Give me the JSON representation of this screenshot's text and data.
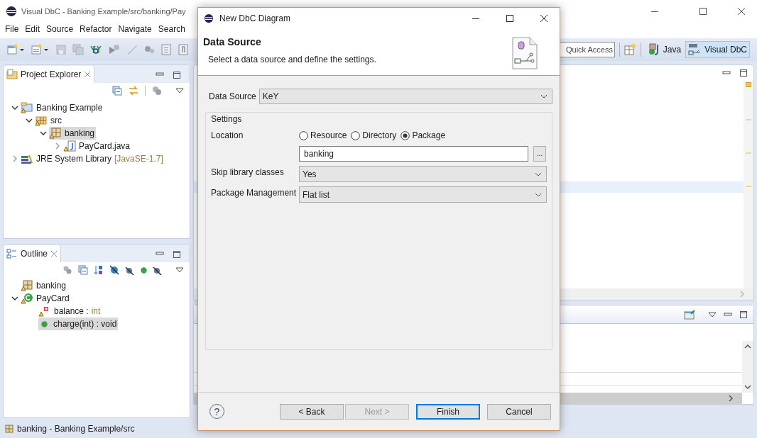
{
  "window": {
    "title": "Visual DbC - Banking Example/src/banking/Pay"
  },
  "menu": [
    "File",
    "Edit",
    "Source",
    "Refactor",
    "Navigate",
    "Search"
  ],
  "quick_access": {
    "placeholder": "Quick Access"
  },
  "perspectives": [
    {
      "label": "Java",
      "kind": "java",
      "selected": false
    },
    {
      "label": "Visual DbC",
      "kind": "dbc",
      "selected": true
    }
  ],
  "project_explorer": {
    "title": "Project Explorer",
    "tree": [
      {
        "label": "Banking Example",
        "kind": "project",
        "expanded": true,
        "selected": false,
        "children": [
          {
            "label": "src",
            "kind": "source-folder",
            "expanded": true,
            "selected": false,
            "children": [
              {
                "label": "banking",
                "kind": "package",
                "expanded": true,
                "selected": true,
                "children": [
                  {
                    "label": "PayCard.java",
                    "kind": "java-file",
                    "expanded": false,
                    "selected": false
                  }
                ]
              }
            ]
          }
        ]
      },
      {
        "label": "JRE System Library",
        "suffix": "[JavaSE-1.7]",
        "kind": "library",
        "expanded": false,
        "selected": false
      }
    ]
  },
  "outline": {
    "title": "Outline",
    "tree": [
      {
        "label": "banking",
        "kind": "package",
        "selected": false
      },
      {
        "label": "PayCard",
        "kind": "class",
        "expanded": true,
        "selected": false,
        "children": [
          {
            "label": "balance :",
            "suffix": "int",
            "kind": "field",
            "selected": false
          },
          {
            "label": "charge(int) : void",
            "kind": "method",
            "selected": true
          }
        ]
      }
    ]
  },
  "status_bar": {
    "text": "banking - Banking Example/src"
  },
  "dialog": {
    "title": "New DbC Diagram",
    "heading": "Data Source",
    "description": "Select a data source and define the settings.",
    "data_source": {
      "label": "Data Source",
      "value": "KeY"
    },
    "settings": {
      "title": "Settings",
      "location": {
        "label": "Location",
        "options": [
          {
            "label": "Resource",
            "selected": false
          },
          {
            "label": "Directory",
            "selected": false
          },
          {
            "label": "Package",
            "selected": true
          }
        ],
        "value": "banking",
        "browse": "..."
      },
      "skip_library_classes": {
        "label": "Skip library classes",
        "value": "Yes"
      },
      "package_management": {
        "label": "Package Management",
        "value": "Flat list"
      }
    },
    "help": "?",
    "buttons": [
      {
        "label": "< Back",
        "disabled": false,
        "default": false
      },
      {
        "label": "Next >",
        "disabled": true,
        "default": false
      },
      {
        "label": "Finish",
        "disabled": false,
        "default": true
      },
      {
        "label": "Cancel",
        "disabled": false,
        "default": false
      }
    ]
  }
}
